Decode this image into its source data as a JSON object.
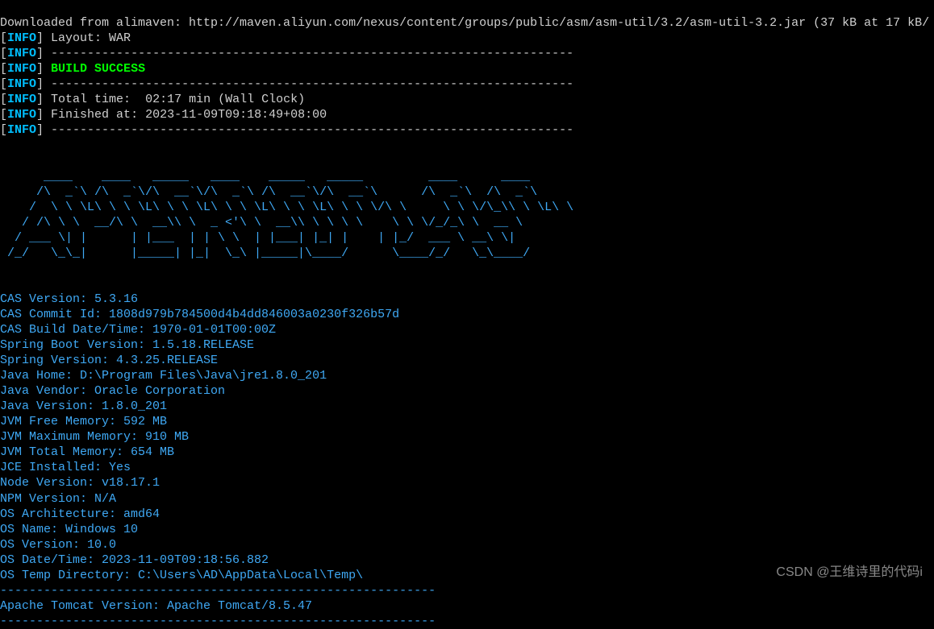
{
  "terminal": {
    "line_download": "Downloaded from alimaven: http://maven.aliyun.com/nexus/content/groups/public/asm/asm-util/3.2/asm-util-3.2.jar (37 kB at 17 kB/",
    "info_label": "INFO",
    "bracket_open": "[",
    "bracket_close": "] ",
    "layout": "Layout: WAR",
    "divider": "------------------------------------------------------------------------",
    "build_success": "BUILD SUCCESS",
    "total_time": "Total time:  02:17 min (Wall Clock)",
    "finished_at": "Finished at: 2023-11-09T09:18:49+08:00",
    "ascii_art": "    __    ____     ____    ____     ____  _____       __    __    __\n   /\\ \\  |  _ \\   |  __|  |  _ \\   |  __||  _  |     / _|  /\\ \\  / _|\n  /  \\ \\ | |_) |  | |__   | |_) |  | |__ | | | |    | |   /  \\ \\ \\ \\ \n / /\\ \\ \\|  __/   |  __|  |  _ <   |  __|| | | |    | |  / /\\ \\ \\ \\ \\\n/ __ \\| |      | |___  | | \\ \\  | |___| |_| |    | |_/ __ \\ _\\ \\|\n/_/   \\_\\_|      |_____| |_|  \\_\\ |_____|\\___/      \\__/_/   \\_\\____/",
    "blank": "",
    "cas_version": "CAS Version: 5.3.16",
    "cas_commit": "CAS Commit Id: 1808d979b784500d4b4dd846003a0230f326b57d",
    "cas_build_date": "CAS Build Date/Time: 1970-01-01T00:00Z",
    "spring_boot": "Spring Boot Version: 1.5.18.RELEASE",
    "spring_version": "Spring Version: 4.3.25.RELEASE",
    "java_home": "Java Home: D:\\Program Files\\Java\\jre1.8.0_201",
    "java_vendor": "Java Vendor: Oracle Corporation",
    "java_version": "Java Version: 1.8.0_201",
    "jvm_free": "JVM Free Memory: 592 MB",
    "jvm_max": "JVM Maximum Memory: 910 MB",
    "jvm_total": "JVM Total Memory: 654 MB",
    "jce": "JCE Installed: Yes",
    "node_version": "Node Version: v18.17.1",
    "npm_version": "NPM Version: N/A",
    "os_arch": "OS Architecture: amd64",
    "os_name": "OS Name: Windows 10",
    "os_version": "OS Version: 10.0",
    "os_date": "OS Date/Time: 2023-11-09T09:18:56.882",
    "os_temp": "OS Temp Directory: C:\\Users\\AD\\AppData\\Local\\Temp\\",
    "cas_divider": "------------------------------------------------------------",
    "tomcat": "Apache Tomcat Version: Apache Tomcat/8.5.47"
  },
  "watermark": "CSDN @王维诗里的代码i"
}
